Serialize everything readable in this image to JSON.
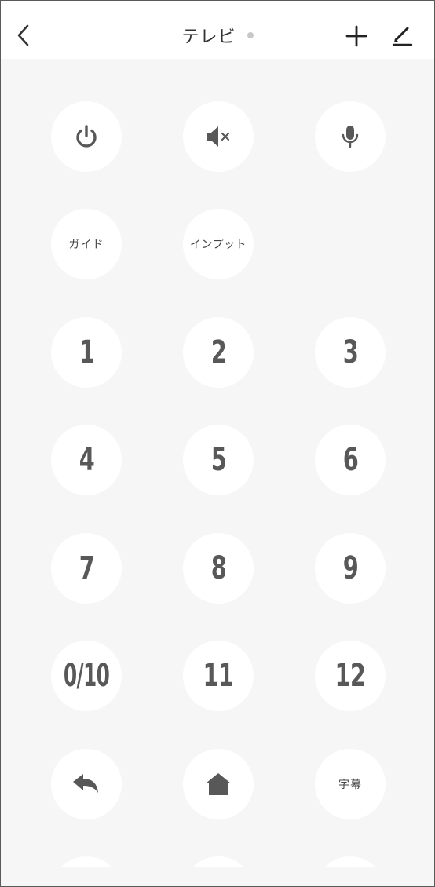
{
  "header": {
    "title": "テレビ"
  },
  "keys": {
    "guide": "ガイド",
    "input": "インプット",
    "n1": "1",
    "n2": "2",
    "n3": "3",
    "n4": "4",
    "n5": "5",
    "n6": "6",
    "n7": "7",
    "n8": "8",
    "n9": "9",
    "n010": "0/10",
    "n11": "11",
    "n12": "12",
    "subtitles": "字幕"
  },
  "icons": {
    "back": "chevron-left-icon",
    "add": "plus-icon",
    "edit": "pencil-icon",
    "power": "power-icon",
    "mute": "mute-icon",
    "mic": "microphone-icon",
    "return": "return-arrow-icon",
    "home": "home-icon"
  },
  "colors": {
    "background": "#f6f6f6",
    "key": "#ffffff",
    "icon": "#585858",
    "status_dot": "#c8c8c8"
  }
}
